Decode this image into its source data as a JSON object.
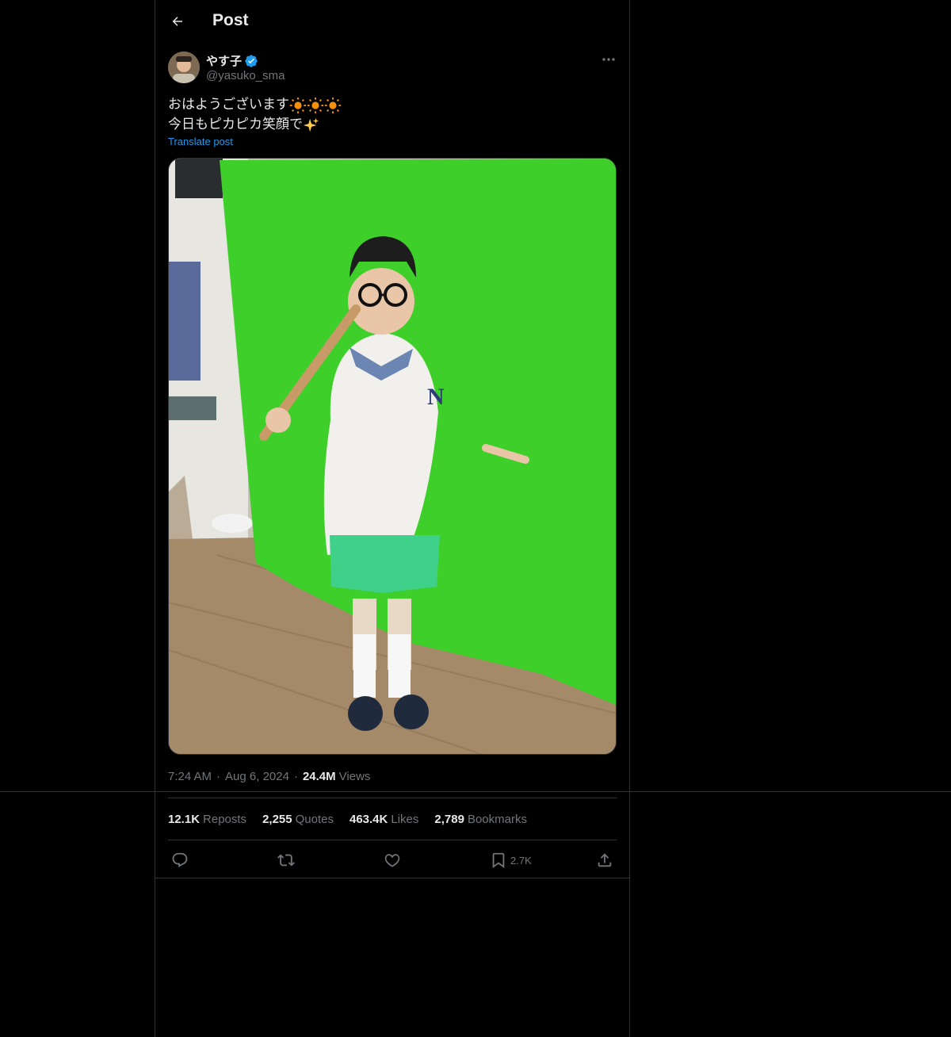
{
  "header": {
    "title": "Post"
  },
  "author": {
    "display_name": "やす子",
    "handle": "@yasuko_sma",
    "verified": true
  },
  "post": {
    "line1": "おはようございます",
    "line2": "今日もピカピカ笑顔で",
    "translate_label": "Translate post"
  },
  "meta": {
    "time": "7:24 AM",
    "separator": "·",
    "date": "Aug 6, 2024",
    "views_count": "24.4M",
    "views_label": "Views"
  },
  "stats": [
    {
      "count": "12.1K",
      "label": "Reposts"
    },
    {
      "count": "2,255",
      "label": "Quotes"
    },
    {
      "count": "463.4K",
      "label": "Likes"
    },
    {
      "count": "2,789",
      "label": "Bookmarks"
    }
  ],
  "actions": {
    "bookmark_count": "2.7K"
  },
  "colors": {
    "accent": "#1d9bf0",
    "muted": "#71767b",
    "text": "#e7e9ea",
    "border": "#2f3336",
    "green_screen": "#3fcf2a"
  }
}
